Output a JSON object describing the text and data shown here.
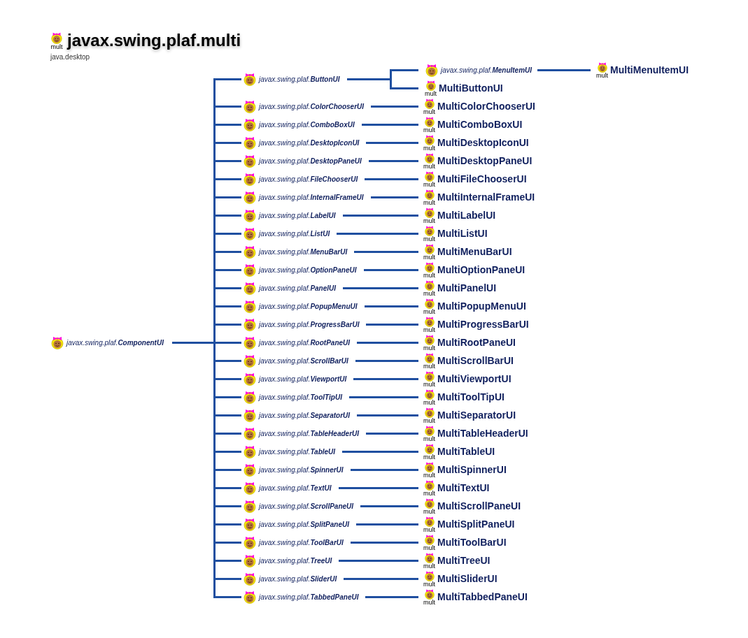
{
  "title_icon_label": "mult",
  "title": "javax.swing.plaf.multi",
  "module": "java.desktop",
  "root": {
    "kind": "abstract",
    "text": "javax.swing.plaf.**ComponentUI**"
  },
  "children": [
    {
      "kind": "abstract",
      "text": "javax.swing.plaf.**ButtonUI**",
      "subclasses": [
        {
          "kind": "abstract",
          "text": "javax.swing.plaf.**MenuItemUI**",
          "subclasses": [
            {
              "kind": "multi",
              "icon_label": "mult",
              "text": "MultiMenuItemUI"
            }
          ]
        },
        {
          "kind": "multi",
          "icon_label": "mult",
          "text": "MultiButtonUI"
        }
      ]
    },
    {
      "kind": "abstract",
      "text": "javax.swing.plaf.**ColorChooserUI**",
      "subclasses": [
        {
          "kind": "multi",
          "icon_label": "mult",
          "text": "MultiColorChooserUI"
        }
      ]
    },
    {
      "kind": "abstract",
      "text": "javax.swing.plaf.**ComboBoxUI**",
      "subclasses": [
        {
          "kind": "multi",
          "icon_label": "mult",
          "text": "MultiComboBoxUI"
        }
      ]
    },
    {
      "kind": "abstract",
      "text": "javax.swing.plaf.**DesktopIconUI**",
      "subclasses": [
        {
          "kind": "multi",
          "icon_label": "mult",
          "text": "MultiDesktopIconUI"
        }
      ]
    },
    {
      "kind": "abstract",
      "text": "javax.swing.plaf.**DesktopPaneUI**",
      "subclasses": [
        {
          "kind": "multi",
          "icon_label": "mult",
          "text": "MultiDesktopPaneUI"
        }
      ]
    },
    {
      "kind": "abstract",
      "text": "javax.swing.plaf.**FileChooserUI**",
      "subclasses": [
        {
          "kind": "multi",
          "icon_label": "mult",
          "text": "MultiFileChooserUI"
        }
      ]
    },
    {
      "kind": "abstract",
      "text": "javax.swing.plaf.**InternalFrameUI**",
      "subclasses": [
        {
          "kind": "multi",
          "icon_label": "mult",
          "text": "MultiInternalFrameUI"
        }
      ]
    },
    {
      "kind": "abstract",
      "text": "javax.swing.plaf.**LabelUI**",
      "subclasses": [
        {
          "kind": "multi",
          "icon_label": "mult",
          "text": "MultiLabelUI"
        }
      ]
    },
    {
      "kind": "abstract",
      "text": "javax.swing.plaf.**ListUI**",
      "subclasses": [
        {
          "kind": "multi",
          "icon_label": "mult",
          "text": "MultiListUI"
        }
      ]
    },
    {
      "kind": "abstract",
      "text": "javax.swing.plaf.**MenuBarUI**",
      "subclasses": [
        {
          "kind": "multi",
          "icon_label": "mult",
          "text": "MultiMenuBarUI"
        }
      ]
    },
    {
      "kind": "abstract",
      "text": "javax.swing.plaf.**OptionPaneUI**",
      "subclasses": [
        {
          "kind": "multi",
          "icon_label": "mult",
          "text": "MultiOptionPaneUI"
        }
      ]
    },
    {
      "kind": "abstract",
      "text": "javax.swing.plaf.**PanelUI**",
      "subclasses": [
        {
          "kind": "multi",
          "icon_label": "mult",
          "text": "MultiPanelUI"
        }
      ]
    },
    {
      "kind": "abstract",
      "text": "javax.swing.plaf.**PopupMenuUI**",
      "subclasses": [
        {
          "kind": "multi",
          "icon_label": "mult",
          "text": "MultiPopupMenuUI"
        }
      ]
    },
    {
      "kind": "abstract",
      "text": "javax.swing.plaf.**ProgressBarUI**",
      "subclasses": [
        {
          "kind": "multi",
          "icon_label": "mult",
          "text": "MultiProgressBarUI"
        }
      ]
    },
    {
      "kind": "abstract",
      "text": "javax.swing.plaf.**RootPaneUI**",
      "subclasses": [
        {
          "kind": "multi",
          "icon_label": "mult",
          "text": "MultiRootPaneUI"
        }
      ]
    },
    {
      "kind": "abstract",
      "text": "javax.swing.plaf.**ScrollBarUI**",
      "subclasses": [
        {
          "kind": "multi",
          "icon_label": "mult",
          "text": "MultiScrollBarUI"
        }
      ]
    },
    {
      "kind": "abstract",
      "text": "javax.swing.plaf.**ViewportUI**",
      "subclasses": [
        {
          "kind": "multi",
          "icon_label": "mult",
          "text": "MultiViewportUI"
        }
      ]
    },
    {
      "kind": "abstract",
      "text": "javax.swing.plaf.**ToolTipUI**",
      "subclasses": [
        {
          "kind": "multi",
          "icon_label": "mult",
          "text": "MultiToolTipUI"
        }
      ]
    },
    {
      "kind": "abstract",
      "text": "javax.swing.plaf.**SeparatorUI**",
      "subclasses": [
        {
          "kind": "multi",
          "icon_label": "mult",
          "text": "MultiSeparatorUI"
        }
      ]
    },
    {
      "kind": "abstract",
      "text": "javax.swing.plaf.**TableHeaderUI**",
      "subclasses": [
        {
          "kind": "multi",
          "icon_label": "mult",
          "text": "MultiTableHeaderUI"
        }
      ]
    },
    {
      "kind": "abstract",
      "text": "javax.swing.plaf.**TableUI**",
      "subclasses": [
        {
          "kind": "multi",
          "icon_label": "mult",
          "text": "MultiTableUI"
        }
      ]
    },
    {
      "kind": "abstract",
      "text": "javax.swing.plaf.**SpinnerUI**",
      "subclasses": [
        {
          "kind": "multi",
          "icon_label": "mult",
          "text": "MultiSpinnerUI"
        }
      ]
    },
    {
      "kind": "abstract",
      "text": "javax.swing.plaf.**TextUI**",
      "subclasses": [
        {
          "kind": "multi",
          "icon_label": "mult",
          "text": "MultiTextUI"
        }
      ]
    },
    {
      "kind": "abstract",
      "text": "javax.swing.plaf.**ScrollPaneUI**",
      "subclasses": [
        {
          "kind": "multi",
          "icon_label": "mult",
          "text": "MultiScrollPaneUI"
        }
      ]
    },
    {
      "kind": "abstract",
      "text": "javax.swing.plaf.**SplitPaneUI**",
      "subclasses": [
        {
          "kind": "multi",
          "icon_label": "mult",
          "text": "MultiSplitPaneUI"
        }
      ]
    },
    {
      "kind": "abstract",
      "text": "javax.swing.plaf.**ToolBarUI**",
      "subclasses": [
        {
          "kind": "multi",
          "icon_label": "mult",
          "text": "MultiToolBarUI"
        }
      ]
    },
    {
      "kind": "abstract",
      "text": "javax.swing.plaf.**TreeUI**",
      "subclasses": [
        {
          "kind": "multi",
          "icon_label": "mult",
          "text": "MultiTreeUI"
        }
      ]
    },
    {
      "kind": "abstract",
      "text": "javax.swing.plaf.**SliderUI**",
      "subclasses": [
        {
          "kind": "multi",
          "icon_label": "mult",
          "text": "MultiSliderUI"
        }
      ]
    },
    {
      "kind": "abstract",
      "text": "javax.swing.plaf.**TabbedPaneUI**",
      "subclasses": [
        {
          "kind": "multi",
          "icon_label": "mult",
          "text": "MultiTabbedPaneUI"
        }
      ]
    }
  ]
}
